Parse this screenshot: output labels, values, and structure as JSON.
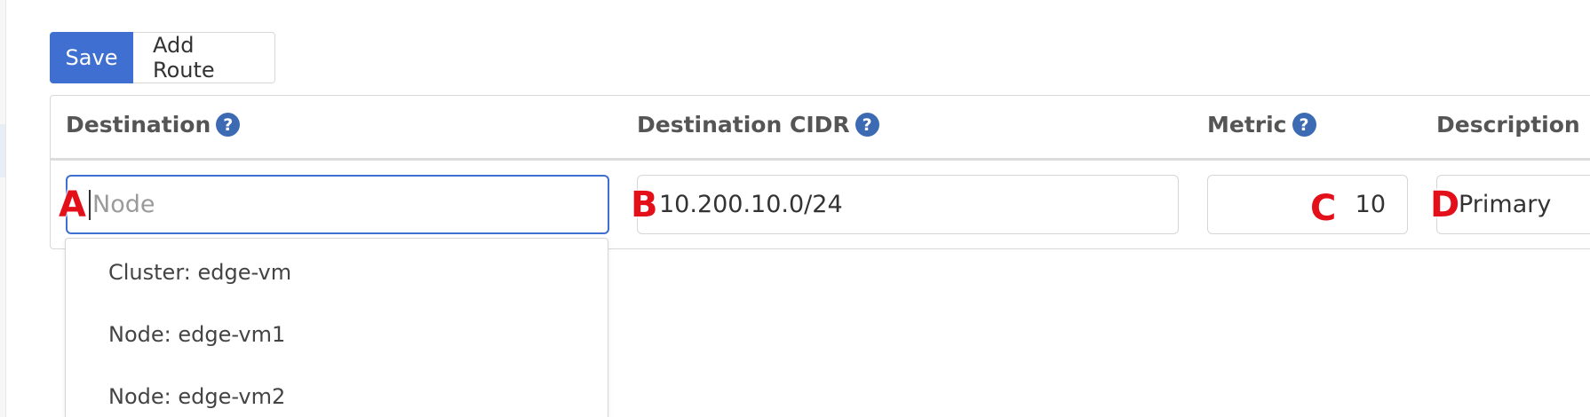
{
  "toolbar": {
    "save_label": "Save",
    "add_route_label": "Add Route"
  },
  "table": {
    "headers": [
      {
        "label": "Destination",
        "help_icon": "question-circle-icon"
      },
      {
        "label": "Destination CIDR",
        "help_icon": "question-circle-icon"
      },
      {
        "label": "Metric",
        "help_icon": "question-circle-icon"
      },
      {
        "label": "Description"
      }
    ],
    "row": {
      "destination": {
        "value": "",
        "placeholder": "Node"
      },
      "cidr": {
        "value": "10.200.10.0/24"
      },
      "metric": {
        "value": "10"
      },
      "description": {
        "value": "Primary"
      }
    }
  },
  "markers": [
    "A",
    "B",
    "C",
    "D"
  ],
  "dropdown": {
    "options": [
      "Cluster: edge-vm",
      "Node: edge-vm1",
      "Node: edge-vm2"
    ]
  },
  "colors": {
    "primary": "#3f6fd1",
    "help_icon": "#3d6bb3",
    "marker": "#e3101a"
  }
}
